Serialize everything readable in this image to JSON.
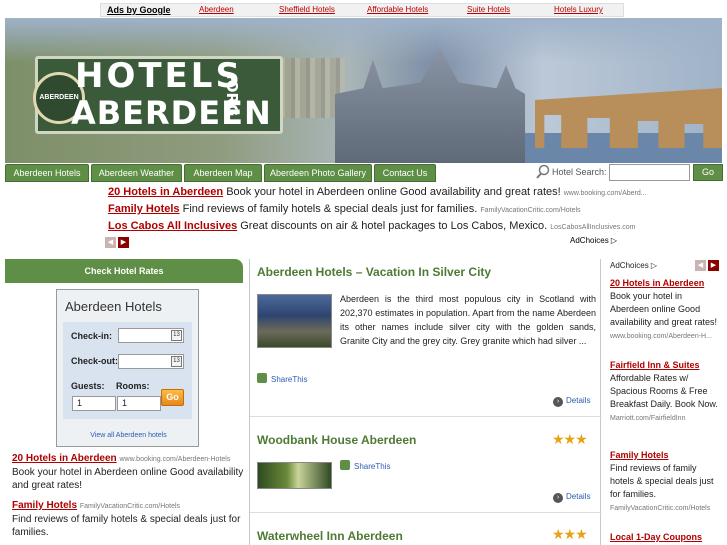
{
  "topstrip": {
    "ads_label": "Ads by Google",
    "links": [
      "Aberdeen",
      "Sheffield Hotels",
      "Affordable Hotels",
      "Suite Hotels",
      "Hotels Luxury"
    ]
  },
  "header": {
    "sign_line1": "HOTELS",
    "sign_line2": "ABERDEEN",
    "sign_suffix": ".ORG",
    "seal_text": "ABERDEEN"
  },
  "nav": {
    "tabs": [
      "Aberdeen Hotels",
      "Aberdeen Weather",
      "Aberdeen Map",
      "Aberdeen Photo Gallery",
      "Contact Us"
    ],
    "search_label": "Hotel Search:",
    "search_placeholder": "",
    "search_button": "Go"
  },
  "top_ads": [
    {
      "title": "20 Hotels in Aberdeen",
      "text": "Book your hotel in Aberdeen online Good availability and great rates!",
      "url": "www.booking.com/Aberd..."
    },
    {
      "title": "Family Hotels",
      "text": "Find reviews of family hotels & special deals just for families.",
      "url": "FamilyVacationCritic.com/Hotels"
    },
    {
      "title": "Los Cabos All Inclusives",
      "text": "Great discounts on air & hotel packages to Los Cabos, Mexico.",
      "url": "LosCabosAllInclusives.com"
    }
  ],
  "adchoices_label": "AdChoices",
  "sidebar": {
    "check_rates": "Check Hotel Rates",
    "box_title": "Aberdeen Hotels",
    "checkin_label": "Check-in:",
    "checkout_label": "Check-out:",
    "guests_label": "Guests:",
    "rooms_label": "Rooms:",
    "guests_value": "1",
    "rooms_value": "1",
    "go_label": "Go",
    "view_all": "View all Aberdeen hotels",
    "ads": [
      {
        "title": "20 Hotels in Aberdeen",
        "url": "www.booking.com/Aberdeen-Hotels",
        "text": "Book your hotel in Aberdeen online Good availability and great rates!"
      },
      {
        "title": "Family Hotels",
        "url": "FamilyVacationCritic.com/Hotels",
        "text": "Find reviews of family hotels & special deals just for families."
      }
    ]
  },
  "main": {
    "articles": [
      {
        "title": "Aberdeen Hotels – Vacation In Silver City",
        "text": "Aberdeen is the third most populous city in Scotland with 202,370 estimates in population. Apart from the name Aberdeen its other names include silver city with the golden sands, Granite City and the grey city. Grey granite which had silver ...",
        "share": "ShareThis",
        "details": "Details"
      },
      {
        "title": "Woodbank House Aberdeen",
        "share": "ShareThis",
        "details": "Details",
        "stars": "★★★"
      },
      {
        "title": "Waterwheel Inn Aberdeen",
        "stars": "★★★"
      }
    ]
  },
  "right": {
    "adchoices": "AdChoices",
    "ads": [
      {
        "title": "20 Hotels in Aberdeen",
        "text": "Book your hotel in Aberdeen online Good availability and great rates!",
        "url": "www.booking.com/Aberdeen-H..."
      },
      {
        "title": "Fairfield Inn & Suites",
        "text": "Affordable Rates w/ Spacious Rooms & Free Breakfast Daily. Book Now.",
        "url": "Marriott.com/FairfieldInn"
      },
      {
        "title": "Family Hotels",
        "text": "Find reviews of family hotels & special deals just for families.",
        "url": "FamilyVacationCritic.com/Hotels"
      },
      {
        "title": "Local 1-Day Coupons",
        "text": "",
        "url": ""
      }
    ]
  },
  "colors": {
    "nav_green": "#5f8f46",
    "ad_title_red": "#b00000",
    "heading_green": "#4d7a35",
    "star_gold": "#e8a315"
  }
}
